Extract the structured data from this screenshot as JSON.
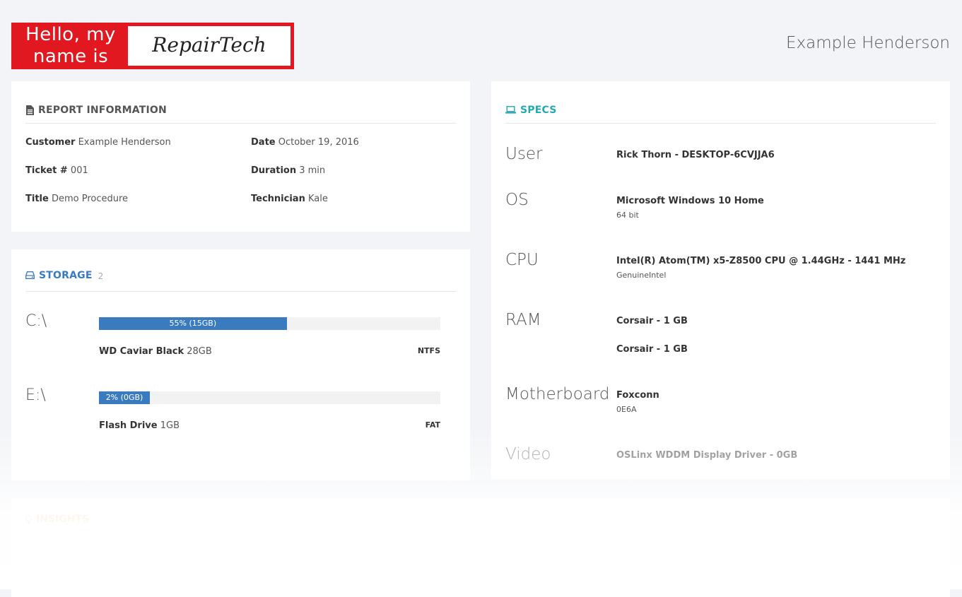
{
  "header": {
    "badge_hello": "Hello, my name is",
    "badge_name": "RepairTech",
    "customer_name": "Example Henderson"
  },
  "report_info": {
    "title": "REPORT INFORMATION",
    "fields": [
      {
        "label": "Customer",
        "value": "Example Henderson"
      },
      {
        "label": "Date",
        "value": "October 19, 2016"
      },
      {
        "label": "Ticket #",
        "value": "001"
      },
      {
        "label": "Duration",
        "value": "3 min"
      },
      {
        "label": "Title",
        "value": "Demo Procedure"
      },
      {
        "label": "Technician",
        "value": "Kale"
      }
    ]
  },
  "storage": {
    "title": "STORAGE",
    "count": "2",
    "drives": [
      {
        "letter": "C:\\",
        "percent": 55,
        "bar_label": "55% (15GB)",
        "name": "WD Caviar Black",
        "size": "28GB",
        "fs": "NTFS"
      },
      {
        "letter": "E:\\",
        "percent": 2,
        "bar_label": "2% (0GB)",
        "name": "Flash Drive",
        "size": "1GB",
        "fs": "FAT"
      }
    ]
  },
  "specs": {
    "title": "SPECS",
    "items": [
      {
        "label": "User",
        "main": "Rick Thorn - DESKTOP-6CVJJA6"
      },
      {
        "label": "OS",
        "main": "Microsoft Windows 10 Home",
        "sub": "64 bit"
      },
      {
        "label": "CPU",
        "main": "Intel(R) Atom(TM) x5-Z8500 CPU @ 1.44GHz - 1441 MHz",
        "sub": "GenuineIntel"
      },
      {
        "label": "RAM",
        "main": "Corsair - 1 GB",
        "main2": "Corsair - 1 GB"
      },
      {
        "label": "Motherboard",
        "main": "Foxconn",
        "sub": "0E6A"
      },
      {
        "label": "Video",
        "main": "OSLinx WDDM Display Driver - 0GB"
      }
    ]
  },
  "insights": {
    "title": "INSIGHTS"
  },
  "colors": {
    "report_title": "#555555",
    "storage_accent": "#3a7bbf",
    "specs_accent": "#23a8b5",
    "insights_accent": "#f0ad4e",
    "badge_red": "#e1181f"
  },
  "icons": {
    "report": "file-text-icon",
    "storage": "hdd-icon",
    "specs": "laptop-icon",
    "insights": "lightbulb-icon"
  }
}
